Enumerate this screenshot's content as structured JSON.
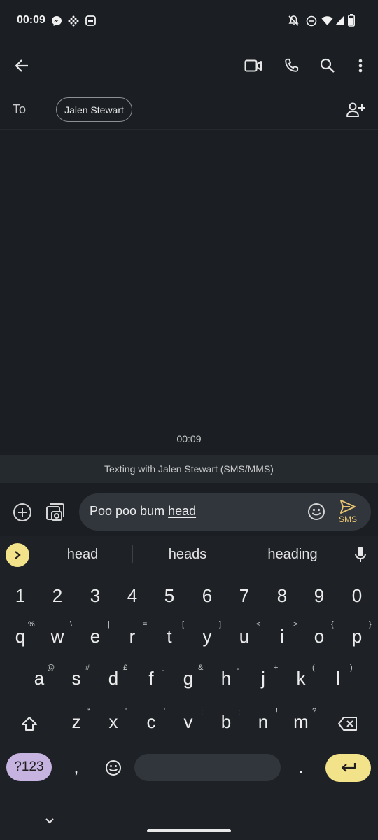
{
  "status_bar": {
    "time": "00:09",
    "left_icons": [
      "messenger-icon",
      "slack-icon",
      "message-icon"
    ],
    "right_icons": [
      "mute-icon",
      "dnd-icon",
      "wifi-icon",
      "signal-icon",
      "battery-icon"
    ]
  },
  "app_bar": {
    "icons": [
      "back-arrow-icon",
      "video-call-icon",
      "phone-icon",
      "search-icon",
      "more-vert-icon"
    ]
  },
  "recipient": {
    "to_label": "To",
    "chip": "Jalen Stewart",
    "add_icon": "add-person-icon"
  },
  "conversation": {
    "timestamp": "00:09",
    "banner": "Texting with Jalen Stewart (SMS/MMS)"
  },
  "compose": {
    "text_before": "Poo poo bum ",
    "text_underlined": "head",
    "send_label": "SMS",
    "send_color": "#e7c36f"
  },
  "keyboard": {
    "suggestions": [
      "head",
      "heads",
      "heading"
    ],
    "numbers": [
      "1",
      "2",
      "3",
      "4",
      "5",
      "6",
      "7",
      "8",
      "9",
      "0"
    ],
    "row1": [
      "q",
      "w",
      "e",
      "r",
      "t",
      "y",
      "u",
      "i",
      "o",
      "p"
    ],
    "row1_hints": [
      "%",
      "\\",
      "|",
      "=",
      "[",
      "]",
      "<",
      ">",
      "{",
      "}"
    ],
    "row2": [
      "a",
      "s",
      "d",
      "f",
      "g",
      "h",
      "j",
      "k",
      "l"
    ],
    "row2_hints": [
      "@",
      "#",
      "£",
      "-",
      "&",
      "-",
      "+",
      "(",
      ")"
    ],
    "row3": [
      "z",
      "x",
      "c",
      "v",
      "b",
      "n",
      "m"
    ],
    "row3_hints": [
      "*",
      "\"",
      "'",
      ":",
      ";",
      "!",
      "?"
    ],
    "symbols_key": "?123",
    "comma": ",",
    "period": ".",
    "accent_123": "#c7b3e0",
    "accent_enter": "#f2e38b"
  }
}
